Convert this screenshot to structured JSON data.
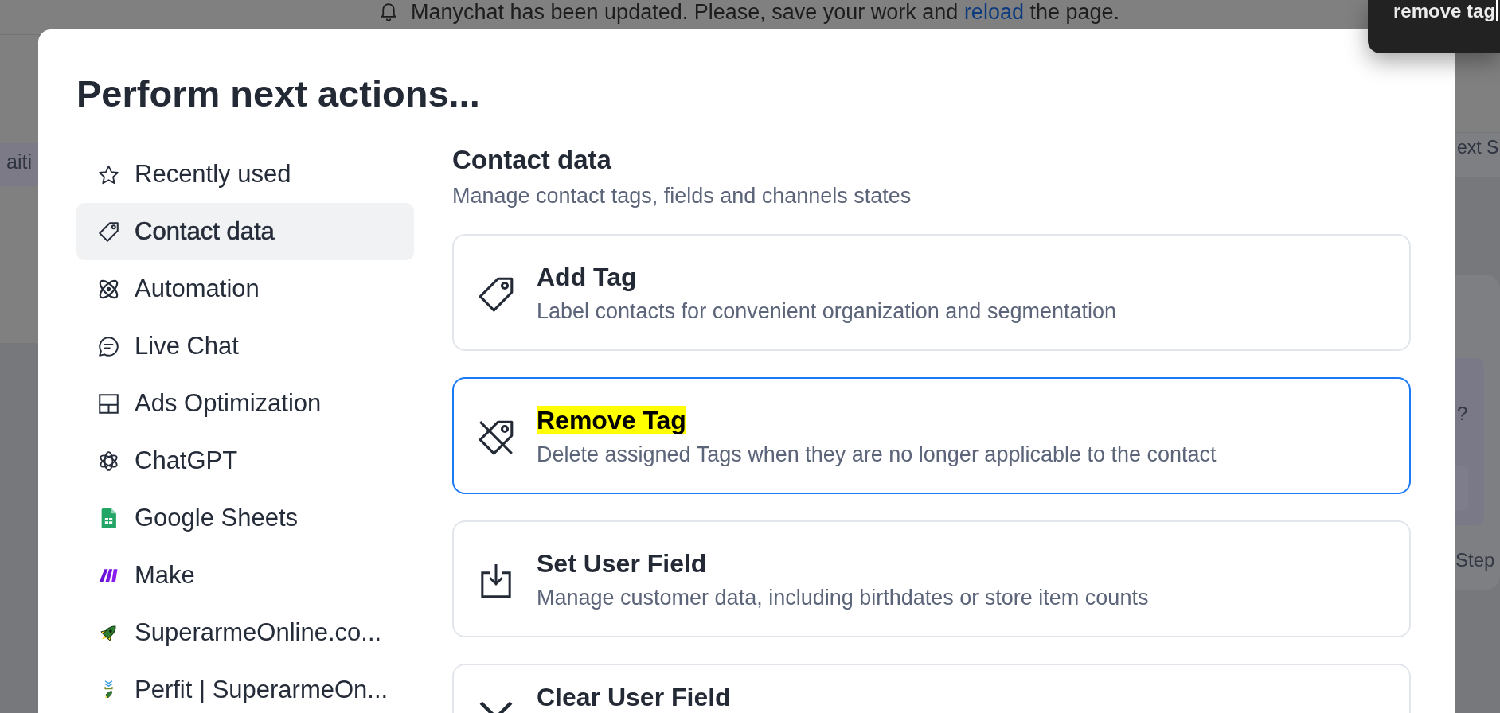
{
  "banner": {
    "text_before": "Manychat has been updated. Please, save your work and",
    "link": "reload",
    "text_after": "the page."
  },
  "search": {
    "value": "remove tag"
  },
  "background": {
    "left_chip": "aiti",
    "right_chip": "ext S",
    "card_text": "?",
    "card_label": "Step"
  },
  "dialog": {
    "title": "Perform next actions..."
  },
  "sidebar": {
    "items": [
      {
        "label": "Recently used",
        "selected": false
      },
      {
        "label": "Contact data",
        "selected": true
      },
      {
        "label": "Automation",
        "selected": false
      },
      {
        "label": "Live Chat",
        "selected": false
      },
      {
        "label": "Ads Optimization",
        "selected": false
      },
      {
        "label": "ChatGPT",
        "selected": false
      },
      {
        "label": "Google Sheets",
        "selected": false
      },
      {
        "label": "Make",
        "selected": false
      },
      {
        "label": "SuperarmeOnline.co...",
        "selected": false
      },
      {
        "label": "Perfit | SuperarmeOn...",
        "selected": false
      }
    ]
  },
  "section": {
    "title": "Contact data",
    "subtitle": "Manage contact tags, fields and channels states"
  },
  "actions": [
    {
      "title": "Add Tag",
      "description": "Label contacts for convenient organization and segmentation",
      "selected": false,
      "highlighted": false
    },
    {
      "title": "Remove Tag",
      "description": "Delete assigned Tags when they are no longer applicable to the contact",
      "selected": true,
      "highlighted": true
    },
    {
      "title": "Set User Field",
      "description": "Manage customer data, including birthdates or store item counts",
      "selected": false,
      "highlighted": false
    },
    {
      "title": "Clear User Field",
      "selected": false,
      "highlighted": false
    }
  ]
}
